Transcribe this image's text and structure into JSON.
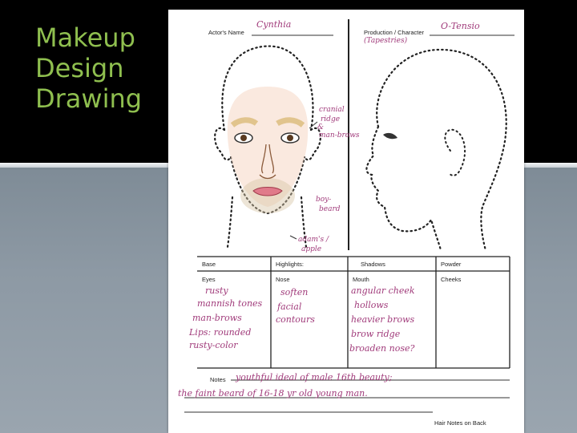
{
  "slide": {
    "title_lines": [
      "Makeup",
      "Design",
      "Drawing"
    ],
    "colors": {
      "title": "#8fbf4f",
      "ink": "#a03a7a",
      "background_top": "#000000",
      "background_bottom": "#8d99a4"
    }
  },
  "sheet": {
    "actor_label": "Actor's Name",
    "actor_value": "Cynthia",
    "production_label": "Production / Character",
    "production_value": "O-Tensio",
    "production_value2": "(Tapestries)",
    "annotations": {
      "cranial_1": "cranial",
      "cranial_2": "ridge",
      "cranial_3": "&",
      "cranial_4": "man-brows",
      "beard_1": "boy-",
      "beard_2": "beard",
      "adams_1": "adam's /",
      "adams_2": "apple"
    },
    "table": {
      "base": "Base",
      "highlights": "Highlights:",
      "shadows": "Shadows",
      "powder": "Powder",
      "eyes": "Eyes",
      "nose": "Nose",
      "mouth": "Mouth",
      "cheeks": "Cheeks"
    },
    "eyes_notes": [
      "rusty",
      "mannish tones",
      "man-brows",
      "Lips: rounded",
      "rusty-color"
    ],
    "nose_notes": [
      "soften",
      "facial",
      "contours"
    ],
    "mouth_notes": [
      "angular cheek",
      "hollows",
      "heavier brows",
      "brow ridge",
      "broaden nose?"
    ],
    "notes_label": "Notes",
    "notes_line1": "youthful ideal of male 16th beauty;",
    "notes_line2": "the faint beard of 16-18 yr old young man.",
    "hair_notes": "Hair Notes on Back"
  }
}
